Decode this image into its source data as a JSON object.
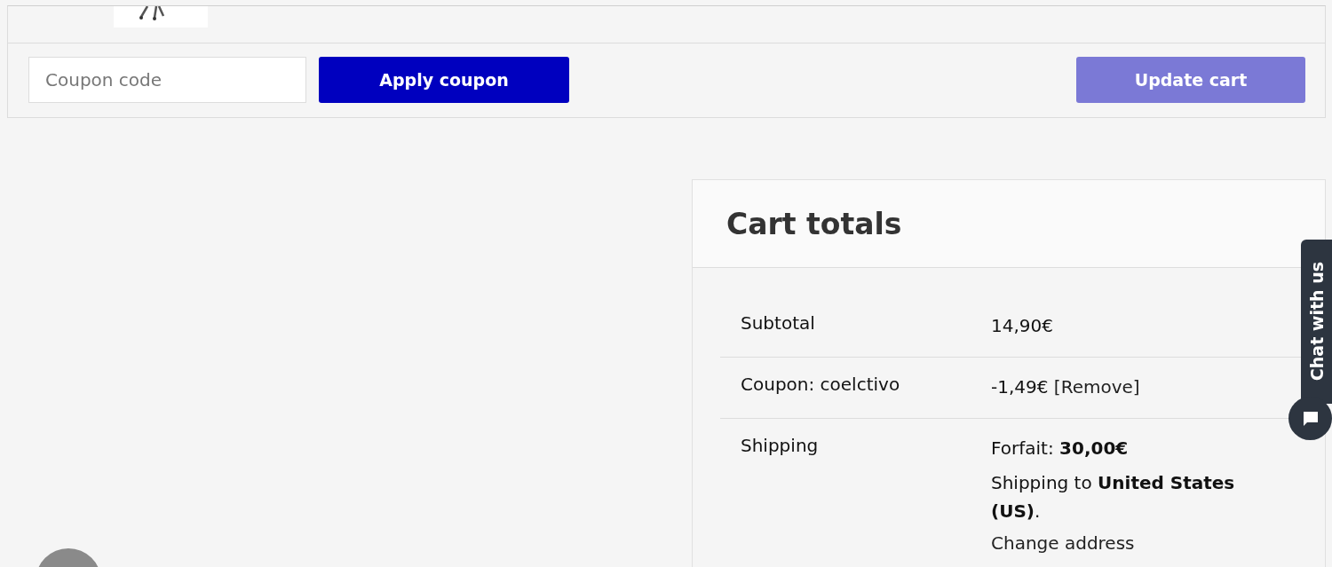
{
  "actions": {
    "coupon_field": {
      "placeholder": "Coupon code"
    },
    "apply_button": {
      "label": "Apply coupon"
    },
    "update_button": {
      "label": "Update cart",
      "disabled": true
    }
  },
  "cart_totals": {
    "title": "Cart totals",
    "rows": [
      {
        "kind": "amount",
        "label": "Subtotal",
        "value": "14,90€"
      },
      {
        "kind": "coupon",
        "label": "Coupon: coelctivo",
        "value": "-1,49€",
        "link": "[Remove]"
      },
      {
        "kind": "shipping",
        "label": "Shipping",
        "method": "Forfait: **30,00€**",
        "destination": "Shipping to **United States (US)**.",
        "link": "Change address"
      }
    ]
  },
  "chat_widget": {
    "label": "Chat with us"
  }
}
